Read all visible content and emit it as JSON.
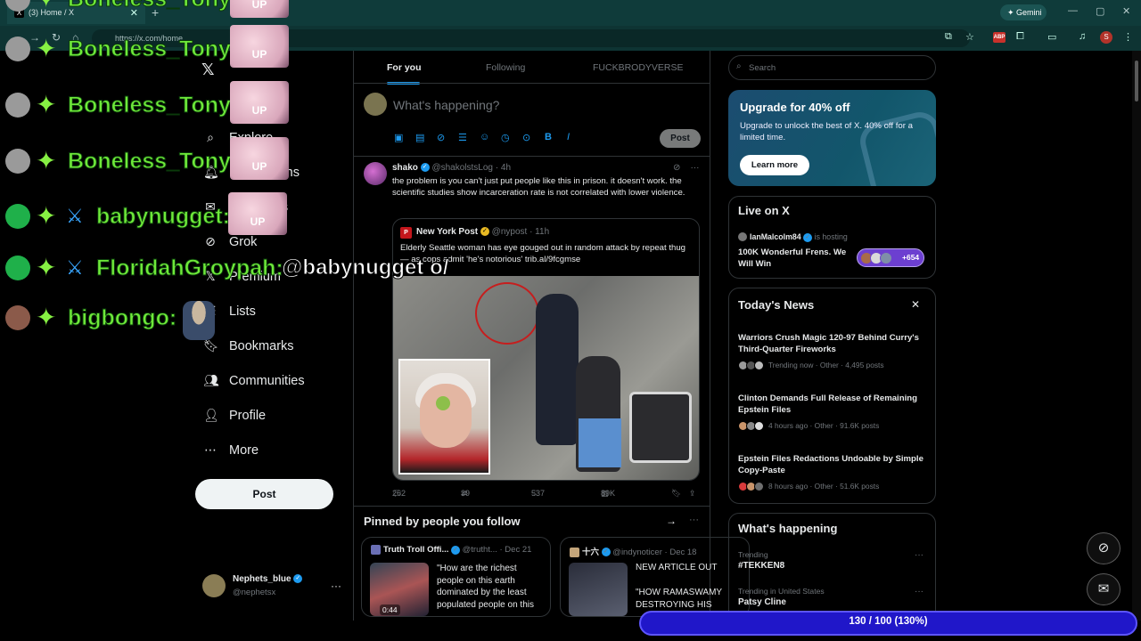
{
  "browser": {
    "tab_title": "(3) Home / X",
    "url": "https://x.com/home",
    "gemini_label": "Gemini",
    "profile_initial": "S",
    "abp_label": "ABP"
  },
  "left_nav": {
    "items": [
      {
        "label": "Explore",
        "icon": "search-icon"
      },
      {
        "label": "Notifications",
        "icon": "bell-icon"
      },
      {
        "label": "Messages",
        "icon": "mail-icon"
      },
      {
        "label": "Grok",
        "icon": "grok-icon"
      },
      {
        "label": "Premium",
        "icon": "x-premium-icon"
      },
      {
        "label": "Lists",
        "icon": "list-icon"
      },
      {
        "label": "Bookmarks",
        "icon": "bookmark-icon"
      },
      {
        "label": "Communities",
        "icon": "communities-icon"
      },
      {
        "label": "Profile",
        "icon": "person-icon"
      },
      {
        "label": "More",
        "icon": "more-circle-icon"
      }
    ],
    "post_label": "Post",
    "account": {
      "name": "Nephets_blue",
      "handle": "@nephetsx"
    }
  },
  "timeline": {
    "tabs": [
      "For you",
      "Following",
      "FUCKBRODYVERSE"
    ],
    "active_tab": "For you",
    "compose_placeholder": "What's happening?",
    "compose_post_label": "Post",
    "tweet": {
      "author": "shako",
      "handle": "@shakolstsLog",
      "time": "· 4h",
      "text": "the problem is you can't just put people like this in prison. it doesn't work. the scientific studies show incarceration rate is not correlated with lower violence.",
      "quote": {
        "author": "New York Post",
        "handle": "@nypost",
        "time": "· 11h",
        "logo_text": "P",
        "text": "Elderly Seattle woman has eye gouged out in random attack by repeat thug — as cops admit 'he's notorious' trib.al/9fcgmse"
      },
      "replies": "262",
      "reposts": "39",
      "likes": "537",
      "views": "89K"
    },
    "pinned": {
      "title": "Pinned by people you follow",
      "cards": [
        {
          "author": "Truth Troll Offi...",
          "handle": "@trutht...",
          "date": "· Dec 21",
          "text": "\"How are the richest people on this earth dominated by the least populated people on this",
          "video_time": "0:44"
        },
        {
          "author": "十六",
          "handle": "@indynoticer",
          "date": "· Dec 18",
          "text_line1": "NEW ARTICLE OUT",
          "text_line2": "\"HOW RAMASWAMY DESTROYING HIS"
        }
      ]
    }
  },
  "sidebar": {
    "search_placeholder": "Search",
    "upgrade": {
      "title": "Upgrade for 40% off",
      "description": "Upgrade to unlock the best of X. 40% off for a limited time.",
      "button": "Learn more"
    },
    "live": {
      "title": "Live on X",
      "host": "IanMalcolm84",
      "host_status": "is hosting",
      "space_title": "100K Wonderful Frens. We Will Win",
      "listener_count": "+654"
    },
    "news": {
      "title": "Today's News",
      "items": [
        {
          "headline": "Warriors Crush Magic 120-97 Behind Curry's Third-Quarter Fireworks",
          "meta": "Trending now · Other · 4,495 posts"
        },
        {
          "headline": "Clinton Demands Full Release of Remaining Epstein Files",
          "meta": "4 hours ago · Other · 91.6K posts"
        },
        {
          "headline": "Epstein Files Redactions Undoable by Simple Copy-Paste",
          "meta": "8 hours ago · Other · 51.6K posts"
        }
      ]
    },
    "happening": {
      "title": "What's happening",
      "trends": [
        {
          "label": "Trending",
          "name": "#TEKKEN8"
        },
        {
          "label": "Trending in United States",
          "name": "Patsy Cline"
        }
      ]
    }
  },
  "overlay": {
    "chat": [
      {
        "name": "Boneless_Tony:",
        "message": "",
        "emote": "UP"
      },
      {
        "name": "Boneless_Tony:",
        "message": "",
        "emote": "UP"
      },
      {
        "name": "Boneless_Tony:",
        "message": "",
        "emote": "UP"
      },
      {
        "name": "Boneless_Tony:",
        "message": "",
        "emote": "UP"
      },
      {
        "name": "babynugget:",
        "message": "",
        "emote": "UP"
      },
      {
        "name": "FloridahGroypah:",
        "message": "@babynugget o/",
        "emote": ""
      },
      {
        "name": "bigbongo:",
        "message": "",
        "emote": ""
      }
    ],
    "goal_text": "130 / 100 (130%)",
    "goal_progress": 1.3
  }
}
